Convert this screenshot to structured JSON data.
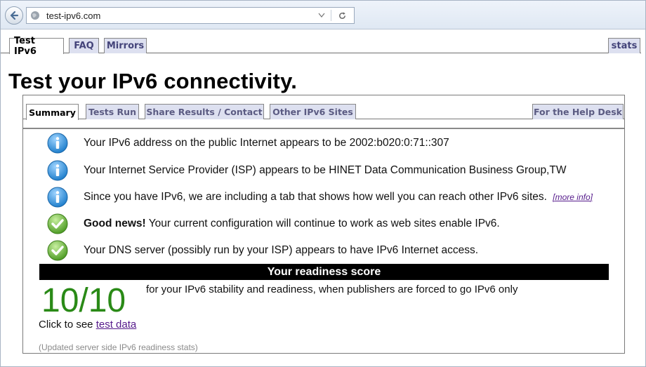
{
  "browser": {
    "url": "test-ipv6.com"
  },
  "top_tabs": [
    {
      "label": "Test IPv6",
      "active": true
    },
    {
      "label": "FAQ",
      "active": false
    },
    {
      "label": "Mirrors",
      "active": false
    },
    {
      "label": "stats",
      "active": false
    }
  ],
  "page_title": "Test your IPv6 connectivity.",
  "inner_tabs": [
    {
      "label": "Summary",
      "active": true
    },
    {
      "label": "Tests Run",
      "active": false
    },
    {
      "label": "Share Results / Contact",
      "active": false
    },
    {
      "label": "Other IPv6 Sites",
      "active": false
    },
    {
      "label": "For the Help Desk",
      "active": false
    }
  ],
  "messages": [
    {
      "icon": "info-icon",
      "bold": "",
      "text": "Your IPv6 address on the public Internet appears to be 2002:b020:0:71::307",
      "link": ""
    },
    {
      "icon": "info-icon",
      "bold": "",
      "text": "Your Internet Service Provider (ISP) appears to be HINET Data Communication Business Group,TW",
      "link": ""
    },
    {
      "icon": "info-icon",
      "bold": "",
      "text": "Since you have IPv6, we are including a tab that shows how well you can reach other IPv6 sites.",
      "link": "[more info]"
    },
    {
      "icon": "check-icon",
      "bold": "Good news!",
      "text": " Your current configuration will continue to work as web sites enable IPv6.",
      "link": ""
    },
    {
      "icon": "check-icon",
      "bold": "",
      "text": "Your DNS server (possibly run by your ISP) appears to have IPv6 Internet access.",
      "link": ""
    }
  ],
  "readiness": {
    "header": "Your readiness score",
    "score": "10/10",
    "description": "for your IPv6 stability and readiness, when publishers are forced to go IPv6 only",
    "click_prefix": "Click to see ",
    "click_link": "test data",
    "updated_note": "(Updated server side IPv6 readiness stats)"
  },
  "colors": {
    "info_icon": "#2a8fd6",
    "check_icon": "#5aad2e",
    "score": "#2a8a17",
    "tab_bg": "#dde0f0"
  }
}
